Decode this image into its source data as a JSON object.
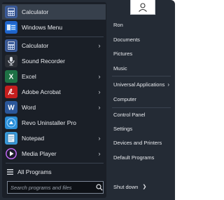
{
  "user": {
    "name": "Ron",
    "avatar_icon": "user-silhouette-icon"
  },
  "pinned": [
    {
      "label": "Calculator",
      "icon": "calculator-icon",
      "color": "#3a5b9a",
      "has_arrow": false
    },
    {
      "label": "Windows Menu",
      "icon": "windows-menu-icon",
      "color": "#1f63c9",
      "has_arrow": false
    }
  ],
  "recent": [
    {
      "label": "Calculator",
      "icon": "calculator-icon",
      "color": "#3a5b9a",
      "has_arrow": true
    },
    {
      "label": "Sound Recorder",
      "icon": "microphone-icon",
      "color": "#2b2f36",
      "has_arrow": false
    },
    {
      "label": "Excel",
      "icon": "excel-icon",
      "color": "#1e7145",
      "has_arrow": true
    },
    {
      "label": "Adobe Acrobat",
      "icon": "acrobat-icon",
      "color": "#c41e1e",
      "has_arrow": true
    },
    {
      "label": "Word",
      "icon": "word-icon",
      "color": "#2b579a",
      "has_arrow": true
    },
    {
      "label": "Revo Uninstaller Pro",
      "icon": "revo-uninstaller-icon",
      "color": "#2a8fd8",
      "has_arrow": false
    },
    {
      "label": "Notepad",
      "icon": "notepad-icon",
      "color": "#3a9ad9",
      "has_arrow": true
    },
    {
      "label": "Media Player",
      "icon": "media-player-icon",
      "color": "#a03ad1",
      "has_arrow": true
    }
  ],
  "all_programs": {
    "label": "All Programs",
    "icon": "all-programs-icon"
  },
  "search": {
    "placeholder": "Search programs and files",
    "icon": "search-icon"
  },
  "right_links": [
    {
      "label": "Ron",
      "has_arrow": false
    },
    {
      "label": "Documents",
      "has_arrow": false
    },
    {
      "label": "Pictures",
      "has_arrow": false
    },
    {
      "label": "Music",
      "has_arrow": false
    },
    {
      "label": "Universal Applications",
      "has_arrow": true
    },
    {
      "label": "Computer",
      "has_arrow": false
    },
    {
      "label": "Control Panel",
      "has_arrow": false
    },
    {
      "label": "Settings",
      "has_arrow": false
    },
    {
      "label": "Devices and Printers",
      "has_arrow": false
    },
    {
      "label": "Default Programs",
      "has_arrow": false
    }
  ],
  "shutdown": {
    "label": "Shut down",
    "arrow": "❯"
  },
  "colors": {
    "panel": "#242b35",
    "left_pane": "#1a1f27",
    "highlight": "#37404c",
    "text": "#e8eaee"
  }
}
